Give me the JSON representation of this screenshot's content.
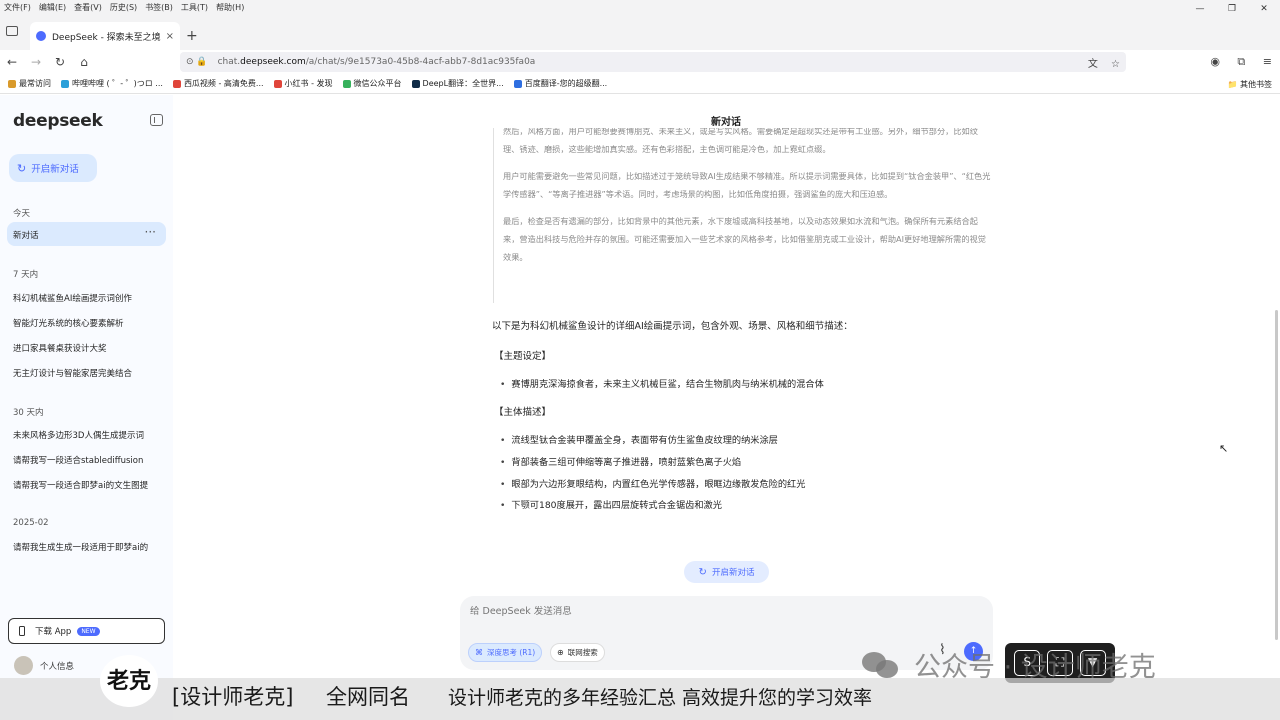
{
  "menu": [
    "文件(F)",
    "编辑(E)",
    "查看(V)",
    "历史(S)",
    "书签(B)",
    "工具(T)",
    "帮助(H)"
  ],
  "tab": {
    "title": "DeepSeek - 探索未至之境",
    "close": "×",
    "new": "+"
  },
  "address": {
    "prefix": "chat.",
    "host": "deepseek.com",
    "path": "/a/chat/s/9e1573a0-45b8-4acf-abb7-8d1ac935fa0a"
  },
  "bookmarks": [
    {
      "label": "最常访问",
      "color": "#d99a2b"
    },
    {
      "label": "哔哩哔哩 ( ゜- ゜)つロ ...",
      "color": "#2b9fd9"
    },
    {
      "label": "西瓜视频 - 高清免费...",
      "color": "#e0453a"
    },
    {
      "label": "小红书 - 发现",
      "color": "#e0453a"
    },
    {
      "label": "微信公众平台",
      "color": "#36b15c"
    },
    {
      "label": "DeepL翻译：全世界...",
      "color": "#0f2b46"
    },
    {
      "label": "百度翻译-您的超级翻...",
      "color": "#2e6ee0"
    }
  ],
  "other_bookmarks": "其他书签",
  "sidebar": {
    "logo": "deepseek",
    "new_chat": "开启新对话",
    "sections": [
      {
        "title": "今天",
        "items": [
          "新对话"
        ]
      },
      {
        "title": "7 天内",
        "items": [
          "科幻机械鲨鱼AI绘画提示词创作",
          "智能灯光系统的核心要素解析",
          "进口家具餐桌获设计大奖",
          "无主灯设计与智能家居完美结合"
        ]
      },
      {
        "title": "30 天内",
        "items": [
          "未来风格多边形3D人偶生成提示词",
          "请帮我写一段适合stablediffusion",
          "请帮我写一段适合即梦ai的文生图提"
        ]
      },
      {
        "title": "2025-02",
        "items": [
          "请帮我生成生成一段适用于即梦ai的"
        ]
      }
    ],
    "more": "···",
    "download": "下载 App",
    "download_badge": "NEW",
    "profile": "个人信息"
  },
  "main": {
    "title": "新对话",
    "thinking": [
      "然后，风格方面，用户可能想要赛博朋克、未来主义，或是写实风格。需要确定是超现实还是带有工业感。另外，细节部分，比如纹理、锈迹、磨损，这些能增加真实感。还有色彩搭配，主色调可能是冷色，加上霓虹点缀。",
      "用户可能需要避免一些常见问题，比如描述过于笼统导致AI生成结果不够精准。所以提示词需要具体，比如提到“钛合金装甲”、“红色光学传感器”、“等离子推进器”等术语。同时，考虑场景的构图，比如低角度拍摄，强调鲨鱼的庞大和压迫感。",
      "最后，检查是否有遗漏的部分，比如背景中的其他元素，水下废墟或高科技基地，以及动态效果如水流和气泡。确保所有元素结合起来，营造出科技与危险并存的氛围。可能还需要加入一些艺术家的风格参考，比如借鉴朋克或工业设计，帮助AI更好地理解所需的视觉效果。"
    ],
    "intro": "以下是为科幻机械鲨鱼设计的详细AI绘画提示词，包含外观、场景、风格和细节描述：",
    "theme_heading": "【主题设定】",
    "theme_items": [
      "赛博朋克深海掠食者，未来主义机械巨鲨，结合生物肌肉与纳米机械的混合体"
    ],
    "body_heading": "【主体描述】",
    "body_items": [
      "流线型钛合金装甲覆盖全身，表面带有仿生鲨鱼皮纹理的纳米涂层",
      "背部装备三组可伸缩等离子推进器，喷射蓝紫色离子火焰",
      "眼部为六边形复眼结构，内置红色光学传感器，眼眶边缘散发危险的红光",
      "下颚可180度展开，露出四层旋转式合金锯齿和激光"
    ],
    "new_chat_pill": "开启新对话"
  },
  "input": {
    "placeholder": "给 DeepSeek 发送消息",
    "deep_think": "深度思考 (R1)",
    "web_search": "联网搜索"
  },
  "overlay": {
    "wechat": "公众号 · 设计师老克",
    "logo_text": "老克",
    "caption1": "[设计师老克]",
    "caption2": "全网同名",
    "caption3": "设计师老克的多年经验汇总  高效提升您的学习效率"
  },
  "colors": {
    "accent": "#4d6bfe",
    "sidebar_bg": "#f9fbff",
    "active_item": "#dbeafe"
  }
}
